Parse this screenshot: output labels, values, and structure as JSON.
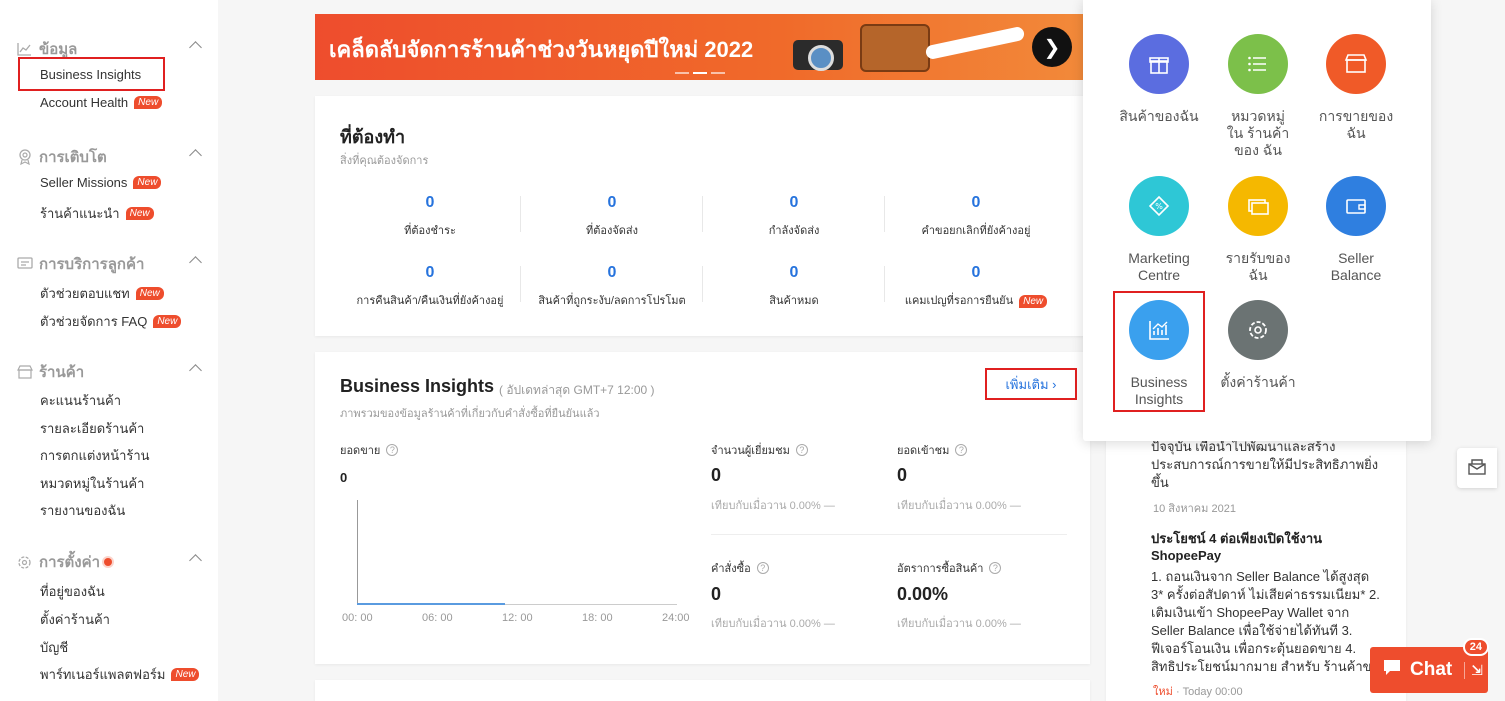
{
  "sidebar": {
    "sections": [
      {
        "title": "ข้อมูล",
        "icon": "chart-line-icon",
        "items": [
          {
            "label": "Business Insights",
            "new": false
          },
          {
            "label": "Account Health",
            "new": true
          }
        ]
      },
      {
        "title": "การเติบโต",
        "icon": "medal-icon",
        "items": [
          {
            "label": "Seller Missions",
            "new": true
          },
          {
            "label": "ร้านค้าแนะนำ",
            "new": true
          }
        ]
      },
      {
        "title": "การบริการลูกค้า",
        "icon": "message-icon",
        "items": [
          {
            "label": "ตัวช่วยตอบแชท",
            "new": true
          },
          {
            "label": "ตัวช่วยจัดการ FAQ",
            "new": true
          }
        ]
      },
      {
        "title": "ร้านค้า",
        "icon": "shop-icon",
        "items": [
          {
            "label": "คะแนนร้านค้า"
          },
          {
            "label": "รายละเอียดร้านค้า"
          },
          {
            "label": "การตกแต่งหน้าร้าน"
          },
          {
            "label": "หมวดหมู่ในร้านค้า"
          },
          {
            "label": "รายงานของฉัน"
          }
        ]
      },
      {
        "title": "การตั้งค่า",
        "icon": "gear-icon",
        "items": [
          {
            "label": "ที่อยู่ของฉัน"
          },
          {
            "label": "ตั้งค่าร้านค้า"
          },
          {
            "label": "บัญชี"
          },
          {
            "label": "พาร์ทเนอร์แพลตฟอร์ม",
            "new": true
          }
        ]
      }
    ],
    "new_badge": "New"
  },
  "banner": {
    "text": "เคล็ดลับจัดการร้านค้าช่วงวันหยุดปีใหม่ 2022",
    "next": "❯"
  },
  "todo": {
    "title": "ที่ต้องทำ",
    "subtitle": "สิ่งที่คุณต้องจัดการ",
    "stats": [
      {
        "value": "0",
        "label": "ที่ต้องชำระ"
      },
      {
        "value": "0",
        "label": "ที่ต้องจัดส่ง"
      },
      {
        "value": "0",
        "label": "กำลังจัดส่ง"
      },
      {
        "value": "0",
        "label": "คำขอยกเลิกที่ยังค้างอยู่"
      },
      {
        "value": "0",
        "label": "การคืนสินค้า/คืนเงินที่ยังค้างอยู่"
      },
      {
        "value": "0",
        "label": "สินค้าที่ถูกระงับ/ลดการโปรโมต"
      },
      {
        "value": "0",
        "label": "สินค้าหมด"
      },
      {
        "value": "0",
        "label": "แคมเปญที่รอการยืนยัน"
      }
    ]
  },
  "insights": {
    "title": "Business Insights",
    "updated": "( อัปเดทล่าสุด GMT+7 12:00 )",
    "subtitle": "ภาพรวมของข้อมูลร้านค้าที่เกี่ยวกับคำสั่งซื้อที่ยืนยันแล้ว",
    "more": "เพิ่มเติม",
    "sales_label": "ยอดขาย",
    "sales_value": "0",
    "xticks": [
      "00: 00",
      "06: 00",
      "12: 00",
      "18: 00",
      "24:00"
    ],
    "metrics": [
      {
        "label": "จำนวนผู้เยี่ยมชม",
        "value": "0",
        "compare": "เทียบกับเมื่อวาน 0.00% —"
      },
      {
        "label": "ยอดเข้าชม",
        "value": "0",
        "compare": "เทียบกับเมื่อวาน 0.00% —"
      },
      {
        "label": "คำสั่งซื้อ",
        "value": "0",
        "compare": "เทียบกับเมื่อวาน 0.00% —"
      },
      {
        "label": "อัตราการซื้อสินค้า",
        "value": "0.00%",
        "compare": "เทียบกับเมื่อวาน 0.00% —"
      }
    ]
  },
  "news": {
    "p1": "ปัจจุบัน เพื่อนำไปพัฒนาและสร้าง",
    "p2": "ประสบการณ์การขายให้มีประสิทธิภาพยิ่ง",
    "p3": "ขึ้น",
    "date1": "10 สิงหาคม 2021",
    "h1": "ประโยชน์ 4 ต่อเพียงเปิดใช้งาน",
    "h2": "ShopeePay",
    "b1": "1. ถอนเงินจาก Seller Balance ได้สูงสุด",
    "b2": "3* ครั้งต่อสัปดาห์ ไม่เสียค่าธรรมเนียม* 2.",
    "b3": "เติมเงินเข้า ShopeePay Wallet จาก",
    "b4": "Seller Balance เพื่อใช้จ่ายได้ทันที 3.",
    "b5": "ฟีเจอร์โอนเงิน เพื่อกระตุ้นยอดขาย 4.",
    "b6": "สิทธิประโยชน์มากมาย สำหรับ ร้านค้าขา",
    "new_tag": "ใหม่",
    "date2": "· Today 00:00"
  },
  "apps": [
    {
      "label": "สินค้าของฉัน",
      "color": "#5b6de0",
      "icon": "gift-icon"
    },
    {
      "label": "หมวดหมู่ใน ร้านค้าของ ฉัน",
      "color": "#7cc04a",
      "icon": "list-icon"
    },
    {
      "label": "การขายของ ฉัน",
      "color": "#f05a28",
      "icon": "store-icon"
    },
    {
      "label": "Marketing Centre",
      "color": "#2ec7d6",
      "icon": "tag-icon"
    },
    {
      "label": "รายรับของ ฉัน",
      "color": "#f5b800",
      "icon": "money-icon"
    },
    {
      "label": "Seller Balance",
      "color": "#2f7fe0",
      "icon": "wallet-icon"
    },
    {
      "label": "Business Insights",
      "color": "#3aa0ee",
      "icon": "chart-icon"
    },
    {
      "label": "ตั้งค่าร้านค้า",
      "color": "#6b7373",
      "icon": "gear-icon"
    }
  ],
  "chat": {
    "label": "Chat",
    "badge": "24"
  }
}
